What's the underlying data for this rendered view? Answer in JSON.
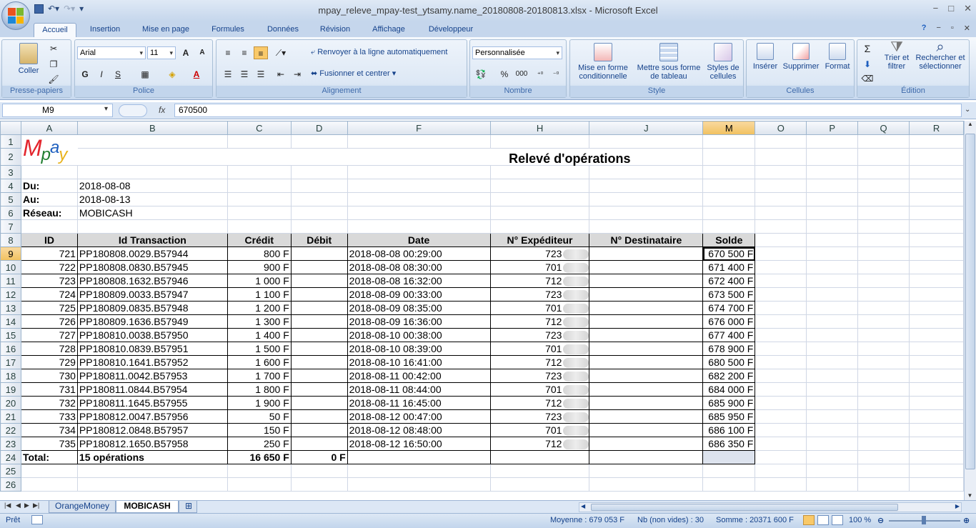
{
  "window": {
    "title": "mpay_releve_mpay-test_ytsamy.name_20180808-20180813.xlsx - Microsoft Excel",
    "controls": [
      "−",
      "□",
      "✕"
    ]
  },
  "ribbon": {
    "tabs": [
      "Accueil",
      "Insertion",
      "Mise en page",
      "Formules",
      "Données",
      "Révision",
      "Affichage",
      "Développeur"
    ],
    "active_tab": "Accueil",
    "clipboard": {
      "paste": "Coller",
      "label": "Presse-papiers"
    },
    "font": {
      "name": "Arial",
      "size": "11",
      "label": "Police",
      "bold": "G",
      "italic": "I",
      "underline": "S"
    },
    "alignment": {
      "wrap": "Renvoyer à la ligne automatiquement",
      "merge": "Fusionner et centrer",
      "label": "Alignement"
    },
    "number": {
      "format": "Personnalisée",
      "percent": "%",
      "thousands": "000",
      "label": "Nombre"
    },
    "style": {
      "conditional": "Mise en forme conditionnelle",
      "table": "Mettre sous forme de tableau",
      "cell_styles": "Styles de cellules",
      "label": "Style"
    },
    "cells": {
      "insert": "Insérer",
      "delete": "Supprimer",
      "format": "Format",
      "label": "Cellules"
    },
    "editing": {
      "sum": "Σ",
      "sort": "Trier et filtrer",
      "find": "Rechercher et sélectionner",
      "label": "Édition"
    }
  },
  "formula_bar": {
    "name_box": "M9",
    "fx": "fx",
    "value": "670500"
  },
  "columns": [
    "A",
    "B",
    "C",
    "D",
    "F",
    "H",
    "J",
    "M",
    "O",
    "P",
    "Q",
    "R"
  ],
  "rows": [
    "1",
    "2",
    "3",
    "4",
    "5",
    "6",
    "7",
    "8",
    "9",
    "10",
    "11",
    "12",
    "13",
    "14",
    "15",
    "16",
    "17",
    "18",
    "19",
    "20",
    "21",
    "22",
    "23",
    "24",
    "25",
    "26"
  ],
  "logo": {
    "letters": [
      "M",
      "p",
      "a",
      "y"
    ],
    "colors": [
      "#e3262e",
      "#1f7d2f",
      "#1e5fbf",
      "#e8b21b"
    ]
  },
  "sheet": {
    "title": "Relevé d'opérations",
    "du_label": "Du:",
    "du_value": "2018-08-08",
    "au_label": "Au:",
    "au_value": "2018-08-13",
    "reseau_label": "Réseau:",
    "reseau_value": "MOBICASH",
    "headers": [
      "ID",
      "Id Transaction",
      "Crédit",
      "Débit",
      "Date",
      "N° Expéditeur",
      "N° Destinataire",
      "Solde"
    ],
    "records": [
      {
        "id": "721",
        "tx": "PP180808.0029.B57944",
        "credit": "800 F",
        "debit": "",
        "date": "2018-08-08 00:29:00",
        "exp": "723",
        "dest": "",
        "solde": "670 500 F"
      },
      {
        "id": "722",
        "tx": "PP180808.0830.B57945",
        "credit": "900 F",
        "debit": "",
        "date": "2018-08-08 08:30:00",
        "exp": "701",
        "dest": "",
        "solde": "671 400 F"
      },
      {
        "id": "723",
        "tx": "PP180808.1632.B57946",
        "credit": "1 000 F",
        "debit": "",
        "date": "2018-08-08 16:32:00",
        "exp": "712",
        "dest": "",
        "solde": "672 400 F"
      },
      {
        "id": "724",
        "tx": "PP180809.0033.B57947",
        "credit": "1 100 F",
        "debit": "",
        "date": "2018-08-09 00:33:00",
        "exp": "723",
        "dest": "",
        "solde": "673 500 F"
      },
      {
        "id": "725",
        "tx": "PP180809.0835.B57948",
        "credit": "1 200 F",
        "debit": "",
        "date": "2018-08-09 08:35:00",
        "exp": "701",
        "dest": "",
        "solde": "674 700 F"
      },
      {
        "id": "726",
        "tx": "PP180809.1636.B57949",
        "credit": "1 300 F",
        "debit": "",
        "date": "2018-08-09 16:36:00",
        "exp": "712",
        "dest": "",
        "solde": "676 000 F"
      },
      {
        "id": "727",
        "tx": "PP180810.0038.B57950",
        "credit": "1 400 F",
        "debit": "",
        "date": "2018-08-10 00:38:00",
        "exp": "723",
        "dest": "",
        "solde": "677 400 F"
      },
      {
        "id": "728",
        "tx": "PP180810.0839.B57951",
        "credit": "1 500 F",
        "debit": "",
        "date": "2018-08-10 08:39:00",
        "exp": "701",
        "dest": "",
        "solde": "678 900 F"
      },
      {
        "id": "729",
        "tx": "PP180810.1641.B57952",
        "credit": "1 600 F",
        "debit": "",
        "date": "2018-08-10 16:41:00",
        "exp": "712",
        "dest": "",
        "solde": "680 500 F"
      },
      {
        "id": "730",
        "tx": "PP180811.0042.B57953",
        "credit": "1 700 F",
        "debit": "",
        "date": "2018-08-11 00:42:00",
        "exp": "723",
        "dest": "",
        "solde": "682 200 F"
      },
      {
        "id": "731",
        "tx": "PP180811.0844.B57954",
        "credit": "1 800 F",
        "debit": "",
        "date": "2018-08-11 08:44:00",
        "exp": "701",
        "dest": "",
        "solde": "684 000 F"
      },
      {
        "id": "732",
        "tx": "PP180811.1645.B57955",
        "credit": "1 900 F",
        "debit": "",
        "date": "2018-08-11 16:45:00",
        "exp": "712",
        "dest": "",
        "solde": "685 900 F"
      },
      {
        "id": "733",
        "tx": "PP180812.0047.B57956",
        "credit": "50 F",
        "debit": "",
        "date": "2018-08-12 00:47:00",
        "exp": "723",
        "dest": "",
        "solde": "685 950 F"
      },
      {
        "id": "734",
        "tx": "PP180812.0848.B57957",
        "credit": "150 F",
        "debit": "",
        "date": "2018-08-12 08:48:00",
        "exp": "701",
        "dest": "",
        "solde": "686 100 F"
      },
      {
        "id": "735",
        "tx": "PP180812.1650.B57958",
        "credit": "250 F",
        "debit": "",
        "date": "2018-08-12 16:50:00",
        "exp": "712",
        "dest": "",
        "solde": "686 350 F"
      }
    ],
    "total": {
      "label": "Total:",
      "count": "15 opérations",
      "credit": "16 650 F",
      "debit": "0 F"
    }
  },
  "sheet_tabs": {
    "tabs": [
      "OrangeMoney",
      "MOBICASH"
    ],
    "active": "MOBICASH"
  },
  "status_bar": {
    "ready": "Prêt",
    "average": "Moyenne : 679 053 F",
    "count": "Nb (non vides) : 30",
    "sum": "Somme : 20371 600 F",
    "zoom": "100 %"
  }
}
